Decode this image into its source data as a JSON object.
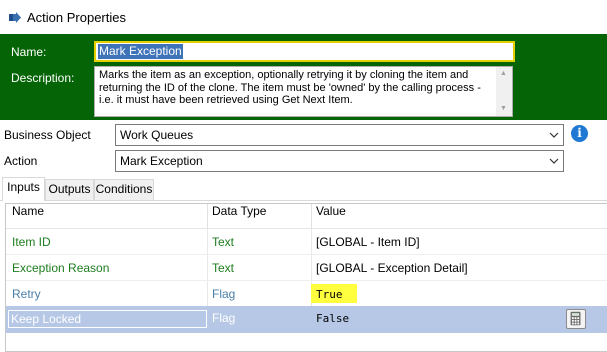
{
  "window": {
    "title": "Action Properties",
    "icon": "process-icon"
  },
  "properties": {
    "name_label": "Name:",
    "name_value": "Mark Exception",
    "description_label": "Description:",
    "description_value": "Marks the item as an exception, optionally retrying it by cloning the item and returning the ID of the clone. The item must be 'owned' by the calling process - i.e. it must have been retrieved using Get Next Item."
  },
  "business_object": {
    "label": "Business Object",
    "selected": "Work Queues"
  },
  "action": {
    "label": "Action",
    "selected": "Mark Exception"
  },
  "tabs": [
    {
      "label": "Inputs",
      "active": true
    },
    {
      "label": "Outputs",
      "active": false
    },
    {
      "label": "Conditions",
      "active": false
    }
  ],
  "grid": {
    "columns": [
      "Name",
      "Data Type",
      "Value"
    ],
    "rows": [
      {
        "name": "Item ID",
        "type": "Text",
        "value": "[GLOBAL - Item ID]"
      },
      {
        "name": "Exception Reason",
        "type": "Text",
        "value": "[GLOBAL - Exception Detail]"
      },
      {
        "name": "Retry",
        "type": "Flag",
        "value": "True"
      },
      {
        "name": "Keep Locked",
        "type": "Flag",
        "value": "False"
      }
    ]
  },
  "colors": {
    "panel_green": "#056405",
    "selection_blue": "#b6c8e6",
    "highlight_yellow": "#ffff40",
    "input_green_text": "#1e7d1e"
  }
}
